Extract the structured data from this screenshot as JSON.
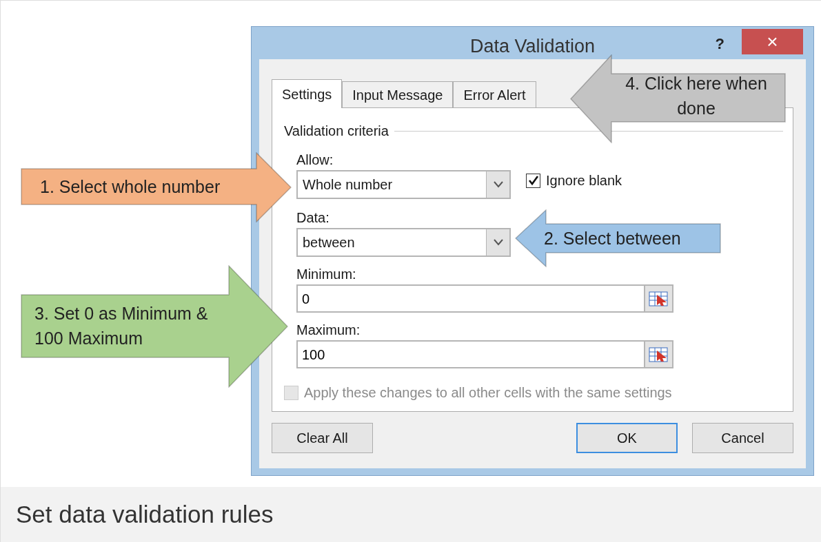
{
  "dialog": {
    "title": "Data Validation",
    "help": "?",
    "close": "×",
    "tabs": [
      {
        "label": "Settings",
        "selected": true
      },
      {
        "label": "Input Message",
        "selected": false
      },
      {
        "label": "Error Alert",
        "selected": false
      }
    ],
    "group_title": "Validation criteria",
    "allow": {
      "label": "Allow:",
      "value": "Whole number"
    },
    "ignore_blank": {
      "label": "Ignore blank",
      "checked": true
    },
    "data": {
      "label": "Data:",
      "value": "between"
    },
    "minimum": {
      "label": "Minimum:",
      "value": "0"
    },
    "maximum": {
      "label": "Maximum:",
      "value": "100"
    },
    "apply_all": {
      "label": "Apply these changes to all other cells with the same settings",
      "checked": false,
      "disabled": true
    },
    "buttons": [
      {
        "label": "Clear All",
        "default": false
      },
      {
        "label": "OK",
        "default": true
      },
      {
        "label": "Cancel",
        "default": false
      }
    ]
  },
  "callouts": [
    {
      "text": "4. Click here when done",
      "kind": "left",
      "color": "#c3c3c3"
    },
    {
      "text": "1. Select whole number",
      "kind": "right",
      "color": "#f4b183"
    },
    {
      "text": "2. Select between",
      "kind": "left",
      "color": "#9dc3e6"
    },
    {
      "text": "3. Set 0 as Minimum & 100 Maximum",
      "kind": "right",
      "color": "#a9d18e"
    }
  ],
  "caption": "Set data validation rules"
}
